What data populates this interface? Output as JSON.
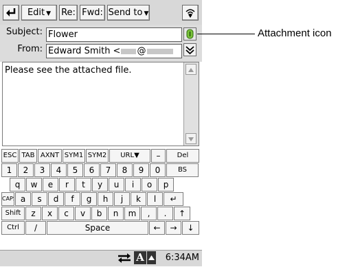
{
  "toolbar": {
    "back_icon": "return-arrow-icon",
    "edit_label": "Edit",
    "reply_label": "Re:",
    "forward_label": "Fwd:",
    "send_to_label": "Send to",
    "signal_icon": "wireless-signal-icon"
  },
  "header": {
    "subject_label": "Subject:",
    "subject_value": "Flower",
    "from_label": "From:",
    "from_value_prefix": "Edward Smith <",
    "from_value_at": "@"
  },
  "body": {
    "text": "Please see the attached file."
  },
  "keyboard": {
    "row1": [
      "ESC",
      "TAB",
      "AXNT",
      "SYM1",
      "SYM2",
      "URL▼",
      "–",
      "Del"
    ],
    "row2": [
      "1",
      "2",
      "3",
      "4",
      "5",
      "6",
      "7",
      "8",
      "9",
      "0",
      "BS"
    ],
    "row3": [
      "q",
      "w",
      "e",
      "r",
      "t",
      "y",
      "u",
      "i",
      "o",
      "p"
    ],
    "row4": [
      "CAPS",
      "a",
      "s",
      "d",
      "f",
      "g",
      "h",
      "j",
      "k",
      "l",
      "↵"
    ],
    "row5": [
      "Shift",
      "z",
      "x",
      "c",
      "v",
      "b",
      "n",
      "m",
      ",",
      ".",
      "↑"
    ],
    "row6": [
      "Ctrl",
      "/",
      "Space",
      "←",
      "→",
      "↓"
    ]
  },
  "taskbar": {
    "time": "6:34AM",
    "input_mode_label": "A"
  },
  "annotation": {
    "label": "Attachment icon"
  }
}
